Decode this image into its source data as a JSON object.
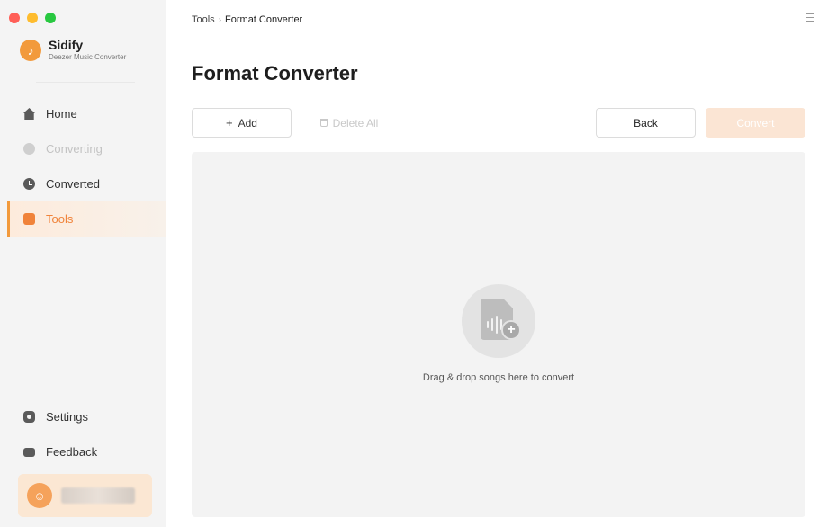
{
  "app": {
    "name": "Sidify",
    "subtitle": "Deezer Music Converter",
    "traffic_colors": [
      "#ff5f57",
      "#febc2e",
      "#28c840"
    ]
  },
  "sidebar": {
    "items": [
      {
        "label": "Home",
        "icon": "home-icon",
        "state": "normal"
      },
      {
        "label": "Converting",
        "icon": "converting-icon",
        "state": "disabled"
      },
      {
        "label": "Converted",
        "icon": "clock-icon",
        "state": "normal"
      },
      {
        "label": "Tools",
        "icon": "toolbox-icon",
        "state": "active"
      }
    ],
    "bottom_items": [
      {
        "label": "Settings",
        "icon": "gear-icon"
      },
      {
        "label": "Feedback",
        "icon": "mail-icon"
      }
    ],
    "account": {
      "avatar_icon": "user-icon"
    }
  },
  "main": {
    "breadcrumb": {
      "parent": "Tools",
      "separator": "›",
      "current": "Format Converter"
    },
    "title": "Format Converter",
    "toolbar": {
      "add_label": "Add",
      "delete_all_label": "Delete All",
      "back_label": "Back",
      "convert_label": "Convert"
    },
    "dropzone": {
      "text": "Drag & drop songs here to convert"
    }
  },
  "colors": {
    "accent": "#f0833a",
    "active_bg": "#fdebdc",
    "convert_disabled_bg": "#fbe5d4"
  }
}
